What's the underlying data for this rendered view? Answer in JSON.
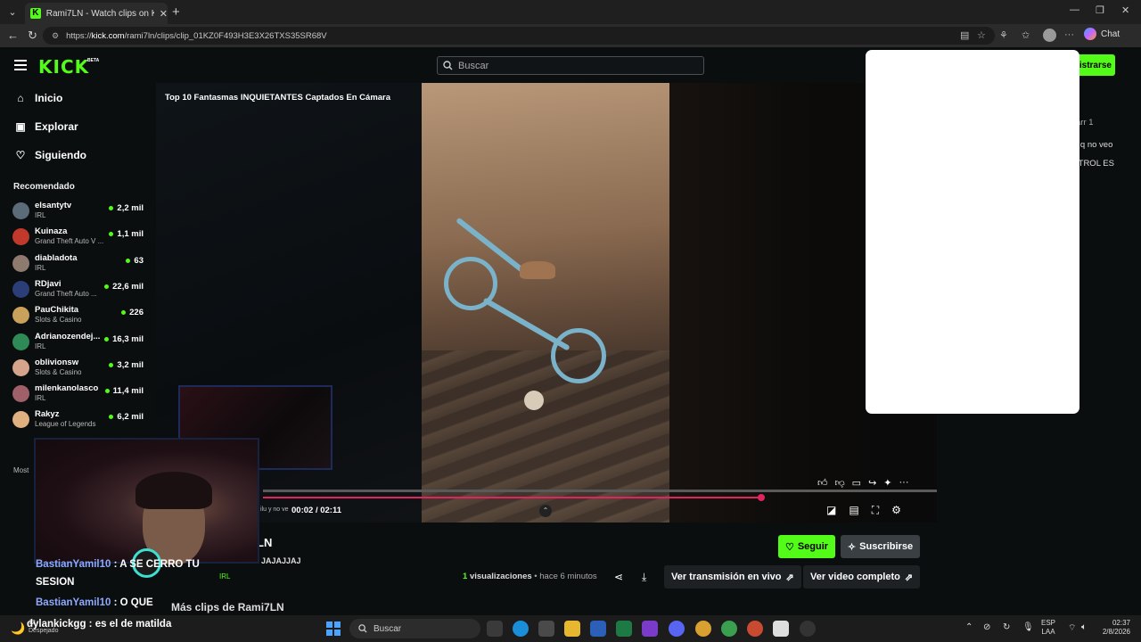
{
  "browser": {
    "tab_title": "Rami7LN - Watch clips on Kick",
    "favicon": "K",
    "url_prefix": "https://",
    "url_host": "kick.com",
    "url_path": "/rami7ln/clips/clip_01KZ0F493H3E3X26TXS35SR68V",
    "chat_label": "Chat"
  },
  "header": {
    "logo": "KICK",
    "beta": "BETA",
    "search_placeholder": "Buscar",
    "register_label": "istrarse"
  },
  "sidebar": {
    "nav": [
      {
        "label": "Inicio",
        "icon": "home-icon"
      },
      {
        "label": "Explorar",
        "icon": "browse-icon"
      },
      {
        "label": "Siguiendo",
        "icon": "heart-icon"
      }
    ],
    "recommended_title": "Recomendado",
    "channels": [
      {
        "name": "elsantytv",
        "category": "IRL",
        "viewers": "2,2 mil",
        "color": "#5b6b78"
      },
      {
        "name": "Kuinaza",
        "category": "Grand Theft Auto V ...",
        "viewers": "1,1 mil",
        "color": "#c0392b"
      },
      {
        "name": "diabladota",
        "category": "IRL",
        "viewers": "63",
        "color": "#8e7a6e"
      },
      {
        "name": "RDjavi",
        "category": "Grand Theft Auto ...",
        "viewers": "22,6 mil",
        "color": "#2c3e78"
      },
      {
        "name": "PauChikita",
        "category": "Slots & Casino",
        "viewers": "226",
        "color": "#c9a15a"
      },
      {
        "name": "Adrianozendej...",
        "category": "IRL",
        "viewers": "16,3 mil",
        "color": "#2e8b57"
      },
      {
        "name": "oblivionsw",
        "category": "Slots & Casino",
        "viewers": "3,2 mil",
        "color": "#d4a58a"
      },
      {
        "name": "milenkanolasco",
        "category": "IRL",
        "viewers": "11,4 mil",
        "color": "#a0606a"
      },
      {
        "name": "Rakyz",
        "category": "League of Legends",
        "viewers": "6,2 mil",
        "color": "#e0b080"
      }
    ],
    "show_more": "Most"
  },
  "player": {
    "clip_title": "Top 10 Fantasmas INQUIETANTES Captados En Cámara",
    "current_time": "00:02",
    "separator": "/",
    "duration": "02:11",
    "progress": 0.74,
    "buffered": 0.77
  },
  "chat_fragments": [
    {
      "text": "arr 1"
    },
    {
      "text": "o q no veo"
    },
    {
      "text": "ITROL ES"
    }
  ],
  "below_video": {
    "streamer_name": "LN",
    "follow_label": "Seguir",
    "subscribe_label": "Suscribirse",
    "views_count": "1",
    "views_label": "visualizaciones",
    "bullet": "•",
    "time_ago": "hace 6 minutos",
    "watch_live_label": "Ver transmisión en vivo",
    "watch_full_label": "Ver video completo",
    "more_clips": "Más clips de Rami7LN",
    "desc_fragment": "JAJAJJAJ",
    "irl_tag": "IRL"
  },
  "overlay": {
    "cam_caption": "ilu y no ve",
    "chat": [
      {
        "user": "BastianYamil10",
        "sep": " : ",
        "msg": "A SE CERRO TU"
      },
      {
        "user": "",
        "sep": "",
        "msg": "SESION"
      },
      {
        "user": "BastianYamil10",
        "sep": " : ",
        "msg": "O QUE"
      },
      {
        "user": "dylankickgg",
        "sep": " : ",
        "msg": "es el de matilda"
      }
    ]
  },
  "taskbar": {
    "weather_line1": "12",
    "weather_line2": "Despejado",
    "search_placeholder": "Buscar",
    "lang_line1": "ESP",
    "lang_line2": "LAA",
    "time": "02:37",
    "date": "2/8/2026"
  },
  "colors": {
    "kick_green": "#53fc18",
    "progress_red": "#e0245e"
  }
}
